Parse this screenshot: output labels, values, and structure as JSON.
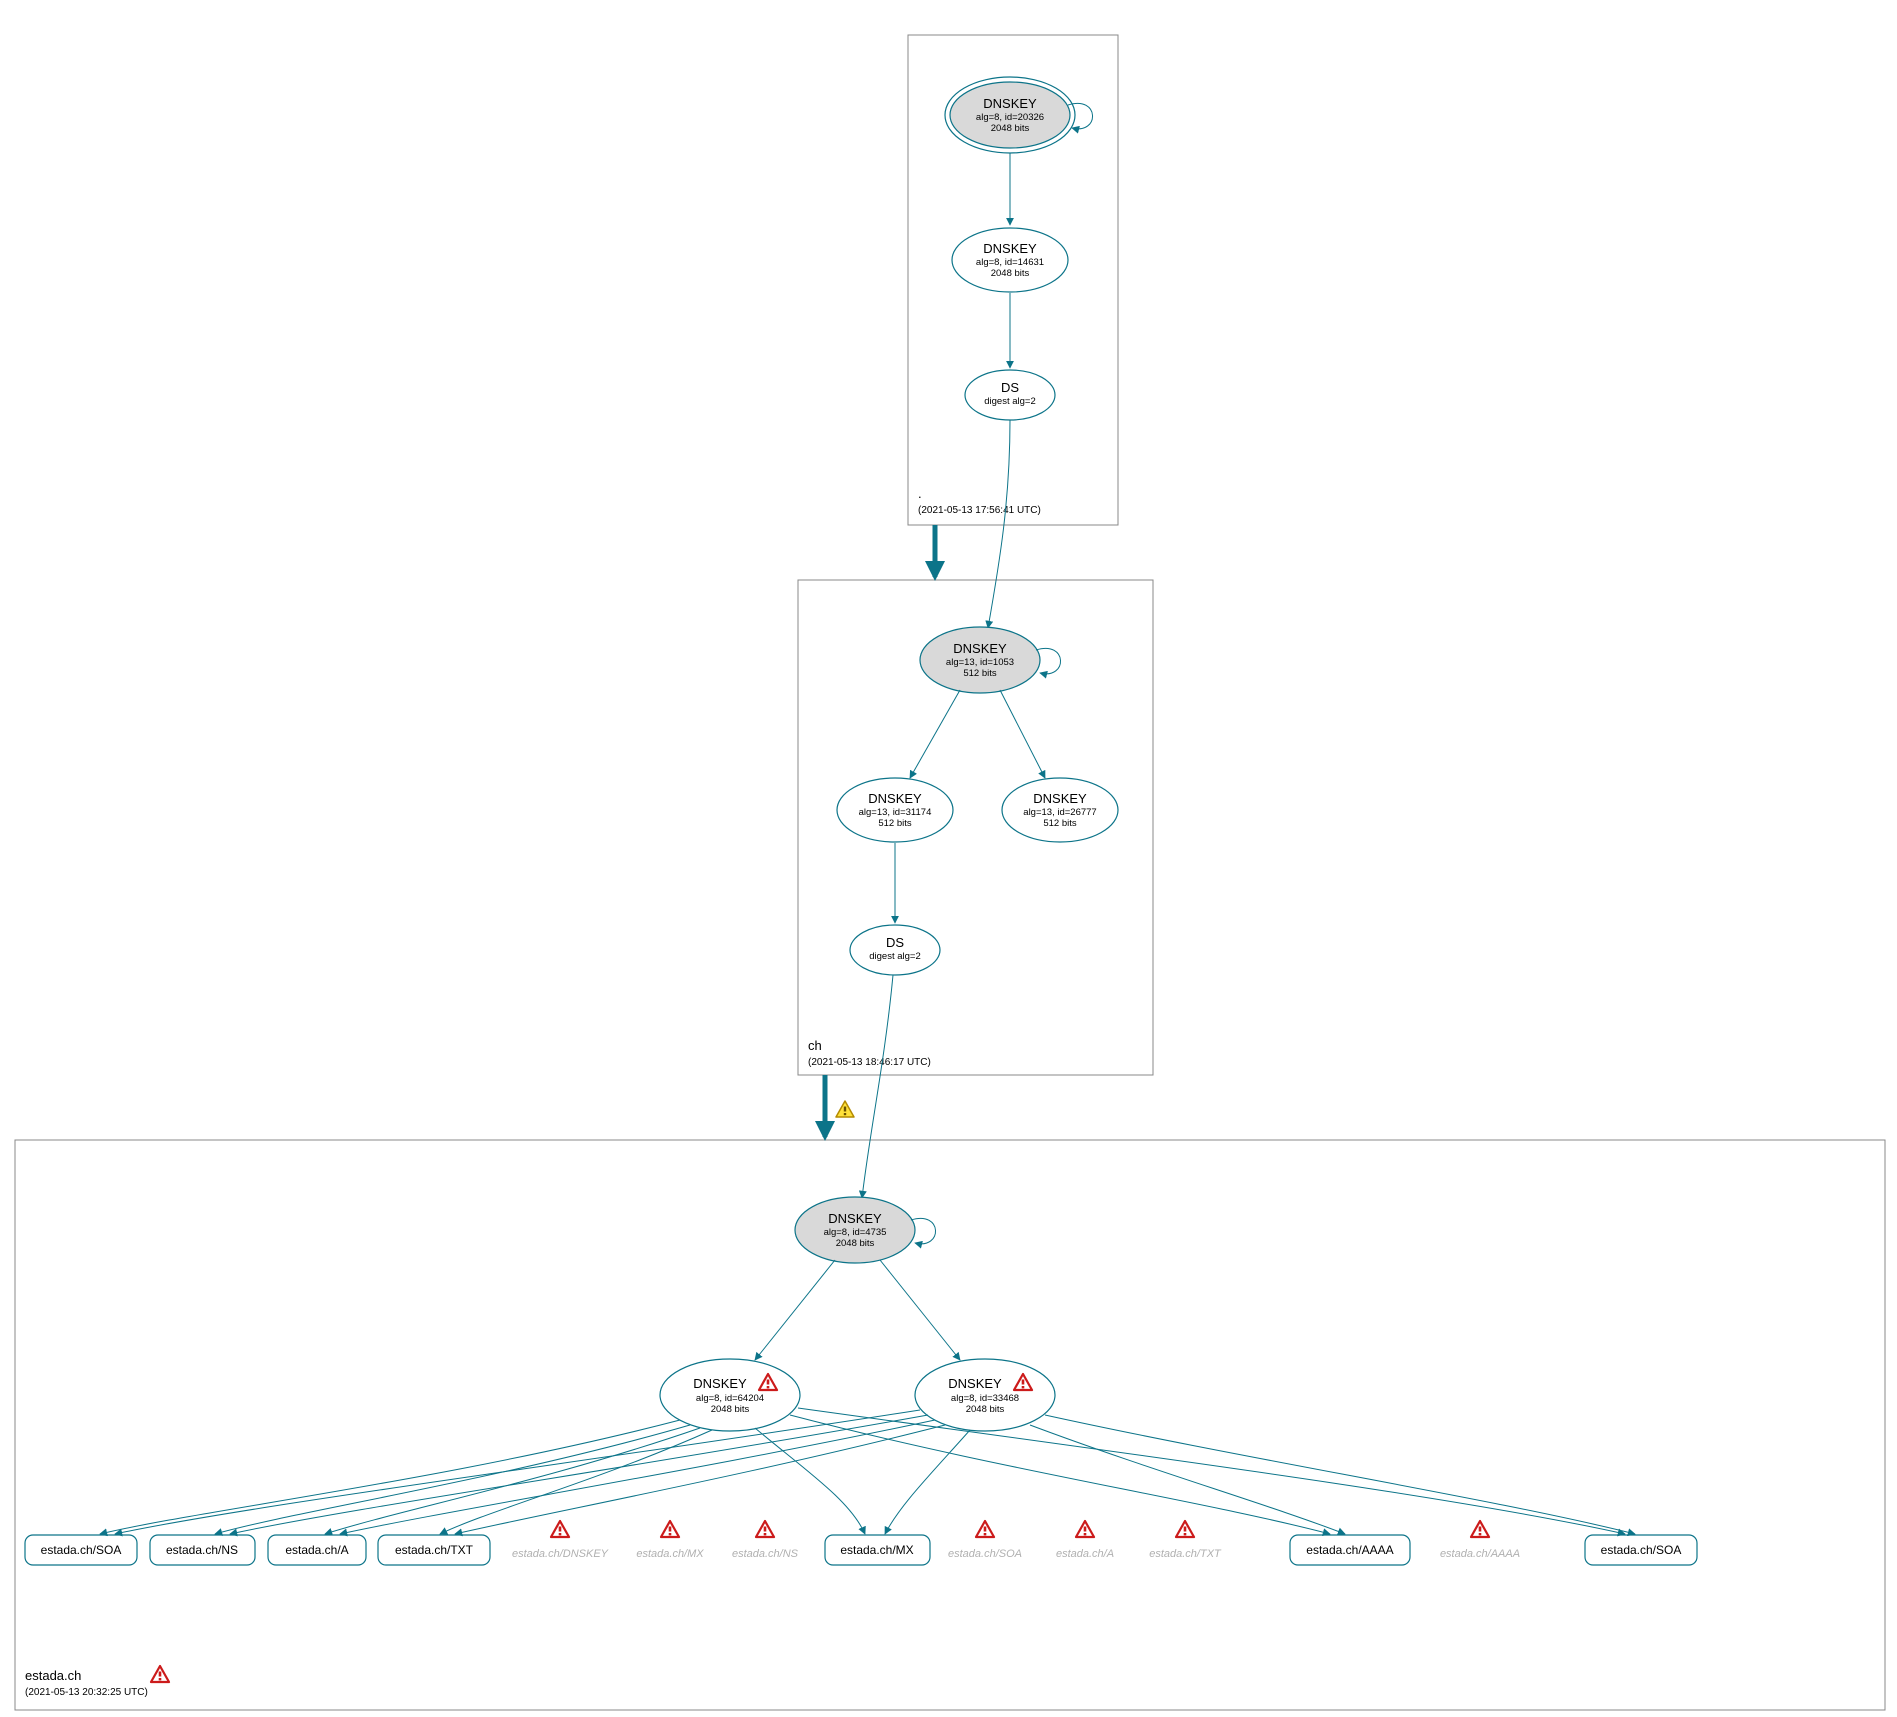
{
  "chart_data": {
    "type": "diagram",
    "description": "DNSSEC delegation / signing graph for domain estada.ch, rendered by DNSViz-style tool.",
    "zones": [
      {
        "name": ".",
        "timestamp": "(2021-05-13 17:56:41 UTC)",
        "nodes": [
          {
            "id": "root-ksk",
            "type": "DNSKEY",
            "ksk": true,
            "alg": 8,
            "key_id": 20326,
            "bits": 2048,
            "self_loop": true,
            "double_ring": true
          },
          {
            "id": "root-zsk",
            "type": "DNSKEY",
            "alg": 8,
            "key_id": 14631,
            "bits": 2048
          },
          {
            "id": "root-ds",
            "type": "DS",
            "digest_alg": 2
          }
        ],
        "edges": [
          {
            "from": "root-ksk",
            "to": "root-zsk"
          },
          {
            "from": "root-zsk",
            "to": "root-ds"
          }
        ]
      },
      {
        "name": "ch",
        "timestamp": "(2021-05-13 18:46:17 UTC)",
        "nodes": [
          {
            "id": "ch-ksk",
            "type": "DNSKEY",
            "ksk": true,
            "alg": 13,
            "key_id": 1053,
            "bits": 512,
            "self_loop": true
          },
          {
            "id": "ch-zsk1",
            "type": "DNSKEY",
            "alg": 13,
            "key_id": 31174,
            "bits": 512
          },
          {
            "id": "ch-zsk2",
            "type": "DNSKEY",
            "alg": 13,
            "key_id": 26777,
            "bits": 512
          },
          {
            "id": "ch-ds",
            "type": "DS",
            "digest_alg": 2
          }
        ],
        "edges": [
          {
            "from": "root-ds",
            "to": "ch-ksk"
          },
          {
            "from": "ch-ksk",
            "to": "ch-zsk1"
          },
          {
            "from": "ch-ksk",
            "to": "ch-zsk2"
          },
          {
            "from": "ch-zsk1",
            "to": "ch-ds"
          }
        ],
        "zone_delegation_edge": {
          "from": "root-zone",
          "to": "ch-zone",
          "thick": true
        }
      },
      {
        "name": "estada.ch",
        "timestamp": "(2021-05-13 20:32:25 UTC)",
        "zone_warning": true,
        "nodes": [
          {
            "id": "e-ksk",
            "type": "DNSKEY",
            "ksk": true,
            "alg": 8,
            "key_id": 4735,
            "bits": 2048,
            "self_loop": true
          },
          {
            "id": "e-zsk1",
            "type": "DNSKEY",
            "alg": 8,
            "key_id": 64204,
            "bits": 2048,
            "warning": true
          },
          {
            "id": "e-zsk2",
            "type": "DNSKEY",
            "alg": 8,
            "key_id": 33468,
            "bits": 2048,
            "warning": true
          }
        ],
        "edges": [
          {
            "from": "ch-ds",
            "to": "e-ksk"
          },
          {
            "from": "e-ksk",
            "to": "e-zsk1"
          },
          {
            "from": "e-ksk",
            "to": "e-zsk2"
          }
        ],
        "zone_delegation_edge": {
          "from": "ch-zone",
          "to": "estada-zone",
          "thick": true,
          "warning": true
        },
        "rrsets_signed": [
          {
            "label": "estada.ch/SOA"
          },
          {
            "label": "estada.ch/NS"
          },
          {
            "label": "estada.ch/A"
          },
          {
            "label": "estada.ch/TXT"
          },
          {
            "label": "estada.ch/MX"
          },
          {
            "label": "estada.ch/AAAA"
          },
          {
            "label": "estada.ch/SOA"
          }
        ],
        "rrsets_missing": [
          {
            "label": "estada.ch/DNSKEY"
          },
          {
            "label": "estada.ch/MX"
          },
          {
            "label": "estada.ch/NS"
          },
          {
            "label": "estada.ch/SOA"
          },
          {
            "label": "estada.ch/A"
          },
          {
            "label": "estada.ch/TXT"
          },
          {
            "label": "estada.ch/AAAA"
          }
        ]
      }
    ]
  },
  "labels": {
    "dnskey": "DNSKEY",
    "ds": "DS",
    "digest_prefix": "digest alg=",
    "alg_prefix": "alg=",
    "id_prefix": "id=",
    "bits_suffix": " bits"
  },
  "z_root": {
    "name": ".",
    "time": "(2021-05-13 17:56:41 UTC)",
    "ksk_l2": "alg=8, id=20326",
    "ksk_l3": "2048 bits",
    "zsk_l2": "alg=8, id=14631",
    "zsk_l3": "2048 bits",
    "ds_l2": "digest alg=2"
  },
  "z_ch": {
    "name": "ch",
    "time": "(2021-05-13 18:46:17 UTC)",
    "ksk_l2": "alg=13, id=1053",
    "ksk_l3": "512 bits",
    "z1_l2": "alg=13, id=31174",
    "z1_l3": "512 bits",
    "z2_l2": "alg=13, id=26777",
    "z2_l3": "512 bits",
    "ds_l2": "digest alg=2"
  },
  "z_e": {
    "name": "estada.ch",
    "time": "(2021-05-13 20:32:25 UTC)",
    "ksk_l2": "alg=8, id=4735",
    "ksk_l3": "2048 bits",
    "z1_l2": "alg=8, id=64204",
    "z1_l3": "2048 bits",
    "z2_l2": "alg=8, id=33468",
    "z2_l3": "2048 bits"
  },
  "rr": {
    "soa1": "estada.ch/SOA",
    "ns": "estada.ch/NS",
    "a": "estada.ch/A",
    "txt": "estada.ch/TXT",
    "mx": "estada.ch/MX",
    "aaaa": "estada.ch/AAAA",
    "soa2": "estada.ch/SOA"
  },
  "ghost": {
    "g1": "estada.ch/DNSKEY",
    "g2": "estada.ch/MX",
    "g3": "estada.ch/NS",
    "g4": "estada.ch/SOA",
    "g5": "estada.ch/A",
    "g6": "estada.ch/TXT",
    "g7": "estada.ch/AAAA"
  }
}
